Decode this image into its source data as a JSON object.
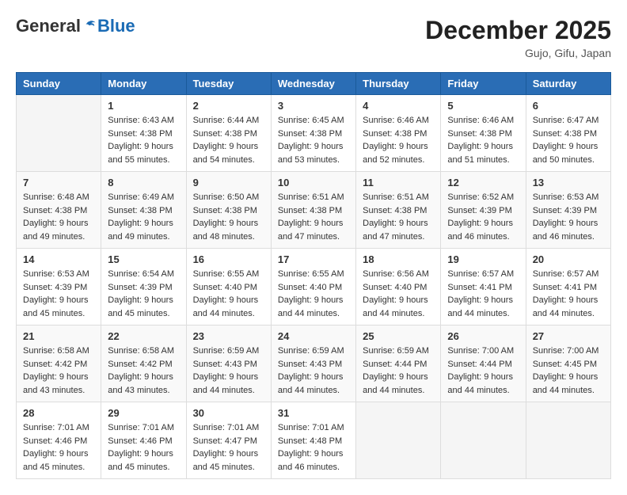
{
  "header": {
    "logo_general": "General",
    "logo_blue": "Blue",
    "month_title": "December 2025",
    "location": "Gujo, Gifu, Japan"
  },
  "weekdays": [
    "Sunday",
    "Monday",
    "Tuesday",
    "Wednesday",
    "Thursday",
    "Friday",
    "Saturday"
  ],
  "weeks": [
    [
      {
        "day": "",
        "info": ""
      },
      {
        "day": "1",
        "info": "Sunrise: 6:43 AM\nSunset: 4:38 PM\nDaylight: 9 hours\nand 55 minutes."
      },
      {
        "day": "2",
        "info": "Sunrise: 6:44 AM\nSunset: 4:38 PM\nDaylight: 9 hours\nand 54 minutes."
      },
      {
        "day": "3",
        "info": "Sunrise: 6:45 AM\nSunset: 4:38 PM\nDaylight: 9 hours\nand 53 minutes."
      },
      {
        "day": "4",
        "info": "Sunrise: 6:46 AM\nSunset: 4:38 PM\nDaylight: 9 hours\nand 52 minutes."
      },
      {
        "day": "5",
        "info": "Sunrise: 6:46 AM\nSunset: 4:38 PM\nDaylight: 9 hours\nand 51 minutes."
      },
      {
        "day": "6",
        "info": "Sunrise: 6:47 AM\nSunset: 4:38 PM\nDaylight: 9 hours\nand 50 minutes."
      }
    ],
    [
      {
        "day": "7",
        "info": "Sunrise: 6:48 AM\nSunset: 4:38 PM\nDaylight: 9 hours\nand 49 minutes."
      },
      {
        "day": "8",
        "info": "Sunrise: 6:49 AM\nSunset: 4:38 PM\nDaylight: 9 hours\nand 49 minutes."
      },
      {
        "day": "9",
        "info": "Sunrise: 6:50 AM\nSunset: 4:38 PM\nDaylight: 9 hours\nand 48 minutes."
      },
      {
        "day": "10",
        "info": "Sunrise: 6:51 AM\nSunset: 4:38 PM\nDaylight: 9 hours\nand 47 minutes."
      },
      {
        "day": "11",
        "info": "Sunrise: 6:51 AM\nSunset: 4:38 PM\nDaylight: 9 hours\nand 47 minutes."
      },
      {
        "day": "12",
        "info": "Sunrise: 6:52 AM\nSunset: 4:39 PM\nDaylight: 9 hours\nand 46 minutes."
      },
      {
        "day": "13",
        "info": "Sunrise: 6:53 AM\nSunset: 4:39 PM\nDaylight: 9 hours\nand 46 minutes."
      }
    ],
    [
      {
        "day": "14",
        "info": "Sunrise: 6:53 AM\nSunset: 4:39 PM\nDaylight: 9 hours\nand 45 minutes."
      },
      {
        "day": "15",
        "info": "Sunrise: 6:54 AM\nSunset: 4:39 PM\nDaylight: 9 hours\nand 45 minutes."
      },
      {
        "day": "16",
        "info": "Sunrise: 6:55 AM\nSunset: 4:40 PM\nDaylight: 9 hours\nand 44 minutes."
      },
      {
        "day": "17",
        "info": "Sunrise: 6:55 AM\nSunset: 4:40 PM\nDaylight: 9 hours\nand 44 minutes."
      },
      {
        "day": "18",
        "info": "Sunrise: 6:56 AM\nSunset: 4:40 PM\nDaylight: 9 hours\nand 44 minutes."
      },
      {
        "day": "19",
        "info": "Sunrise: 6:57 AM\nSunset: 4:41 PM\nDaylight: 9 hours\nand 44 minutes."
      },
      {
        "day": "20",
        "info": "Sunrise: 6:57 AM\nSunset: 4:41 PM\nDaylight: 9 hours\nand 44 minutes."
      }
    ],
    [
      {
        "day": "21",
        "info": "Sunrise: 6:58 AM\nSunset: 4:42 PM\nDaylight: 9 hours\nand 43 minutes."
      },
      {
        "day": "22",
        "info": "Sunrise: 6:58 AM\nSunset: 4:42 PM\nDaylight: 9 hours\nand 43 minutes."
      },
      {
        "day": "23",
        "info": "Sunrise: 6:59 AM\nSunset: 4:43 PM\nDaylight: 9 hours\nand 44 minutes."
      },
      {
        "day": "24",
        "info": "Sunrise: 6:59 AM\nSunset: 4:43 PM\nDaylight: 9 hours\nand 44 minutes."
      },
      {
        "day": "25",
        "info": "Sunrise: 6:59 AM\nSunset: 4:44 PM\nDaylight: 9 hours\nand 44 minutes."
      },
      {
        "day": "26",
        "info": "Sunrise: 7:00 AM\nSunset: 4:44 PM\nDaylight: 9 hours\nand 44 minutes."
      },
      {
        "day": "27",
        "info": "Sunrise: 7:00 AM\nSunset: 4:45 PM\nDaylight: 9 hours\nand 44 minutes."
      }
    ],
    [
      {
        "day": "28",
        "info": "Sunrise: 7:01 AM\nSunset: 4:46 PM\nDaylight: 9 hours\nand 45 minutes."
      },
      {
        "day": "29",
        "info": "Sunrise: 7:01 AM\nSunset: 4:46 PM\nDaylight: 9 hours\nand 45 minutes."
      },
      {
        "day": "30",
        "info": "Sunrise: 7:01 AM\nSunset: 4:47 PM\nDaylight: 9 hours\nand 45 minutes."
      },
      {
        "day": "31",
        "info": "Sunrise: 7:01 AM\nSunset: 4:48 PM\nDaylight: 9 hours\nand 46 minutes."
      },
      {
        "day": "",
        "info": ""
      },
      {
        "day": "",
        "info": ""
      },
      {
        "day": "",
        "info": ""
      }
    ]
  ]
}
